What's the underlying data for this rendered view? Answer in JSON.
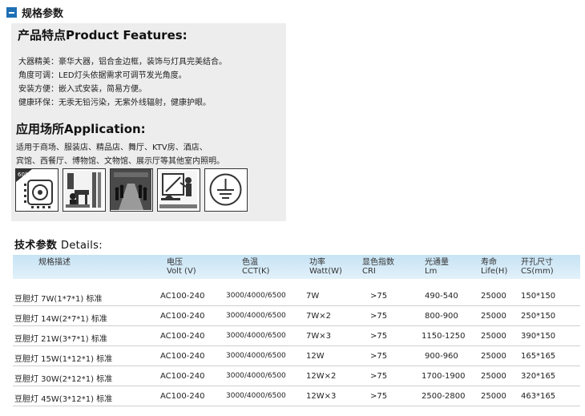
{
  "header": {
    "title": "规格参数",
    "icon": "minus-square-icon",
    "icon_color": "#1f6fb5"
  },
  "features": {
    "title": "产品特点Product Features:",
    "lines": [
      "大器精美：豪华大器，铝合金边框，装饰与灯具完美结合。",
      "角度可调：LED灯头依据需求可调节发光角度。",
      "安装方便：嵌入式安装，简易方便。",
      "健康环保：无汞无铅污染，无紫外线辐射，健康护眼。"
    ]
  },
  "application": {
    "title": "应用场所Application:",
    "lines": [
      "适用于商场、服装店、精品店、舞厅、KTV房、酒店、",
      "宾馆、西餐厅、博物馆、文物馆、展示厅等其他室内照明。"
    ],
    "icon_badge": "60°",
    "icons": [
      "adjustable-angle-icon",
      "shop-interior-icon",
      "exhibition-hall-icon",
      "office-presentation-icon",
      "ground-symbol-icon"
    ]
  },
  "details": {
    "title_cn": "技术参数",
    "title_en": "Details:",
    "header_color": "#c7e3f4",
    "columns": [
      {
        "cn": "规格描述",
        "en": ""
      },
      {
        "cn": "电压",
        "en": "Volt (V)"
      },
      {
        "cn": "色温",
        "en": "CCT(K)"
      },
      {
        "cn": "功率",
        "en": "Watt(W)"
      },
      {
        "cn": "显色指数",
        "en": "CRI"
      },
      {
        "cn": "光通量",
        "en": "Lm"
      },
      {
        "cn": "寿命",
        "en": "Life(H)"
      },
      {
        "cn": "开孔尺寸",
        "en": "CS(mm)"
      }
    ],
    "rows": [
      {
        "name": "豆胆灯 7W(1*7*1) 标准",
        "volt": "AC100-240",
        "cct": "3000/4000/6500",
        "watt": "7W",
        "cri": ">75",
        "lm": "490-540",
        "life": "25000",
        "cs": "150*150"
      },
      {
        "name": "豆胆灯 14W(2*7*1) 标准",
        "volt": "AC100-240",
        "cct": "3000/4000/6500",
        "watt": "7W×2",
        "cri": ">75",
        "lm": "800-900",
        "life": "25000",
        "cs": "250*150"
      },
      {
        "name": "豆胆灯 21W(3*7*1) 标准",
        "volt": "AC100-240",
        "cct": "3000/4000/6500",
        "watt": "7W×3",
        "cri": ">75",
        "lm": "1150-1250",
        "life": "25000",
        "cs": "390*150"
      },
      {
        "name": "豆胆灯 15W(1*12*1) 标准",
        "volt": "AC100-240",
        "cct": "3000/4000/6500",
        "watt": "12W",
        "cri": ">75",
        "lm": "900-960",
        "life": "25000",
        "cs": "165*165"
      },
      {
        "name": "豆胆灯 30W(2*12*1) 标准",
        "volt": "AC100-240",
        "cct": "3000/4000/6500",
        "watt": "12W×2",
        "cri": ">75",
        "lm": "1700-1900",
        "life": "25000",
        "cs": "320*165"
      },
      {
        "name": "豆胆灯 45W(3*12*1) 标准",
        "volt": "AC100-240",
        "cct": "3000/4000/6500",
        "watt": "12W×3",
        "cri": ">75",
        "lm": "2500-2800",
        "life": "25000",
        "cs": "463*165"
      }
    ]
  }
}
